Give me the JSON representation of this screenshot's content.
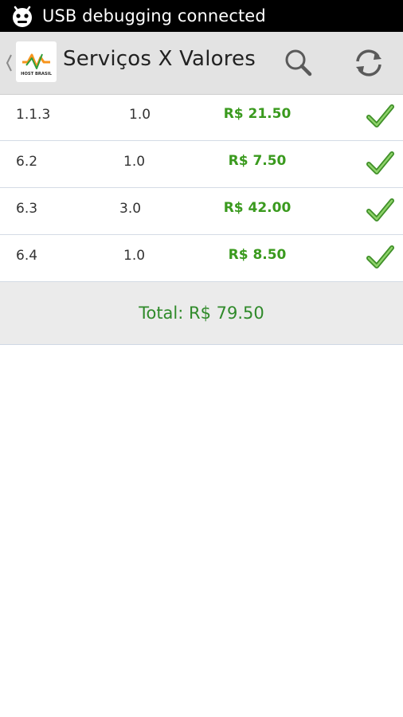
{
  "status_bar": {
    "notification_text": "USB debugging connected",
    "icon": "android-debug-icon"
  },
  "action_bar": {
    "title": "Serviços X Valores",
    "logo_text": "HOST BRASIL",
    "icons": [
      "up-caret-icon",
      "search-icon",
      "refresh-icon"
    ]
  },
  "items": [
    {
      "code": "1.1.3",
      "qty": "1.0",
      "price": "R$ 21.50",
      "checked": true
    },
    {
      "code": "6.2",
      "qty": "1.0",
      "price": "R$ 7.50",
      "checked": true
    },
    {
      "code": "6.3",
      "qty": "3.0",
      "price": "R$ 42.00",
      "checked": true
    },
    {
      "code": "6.4",
      "qty": "1.0",
      "price": "R$ 8.50",
      "checked": true
    }
  ],
  "total": {
    "label": "Total: R$ 79.50"
  },
  "colors": {
    "status_bar": "#000000",
    "action_bar": "#e3e3e3",
    "price_green": "#3a9a1e",
    "check_green": "#4caf32",
    "total_bar": "#ebebeb"
  }
}
